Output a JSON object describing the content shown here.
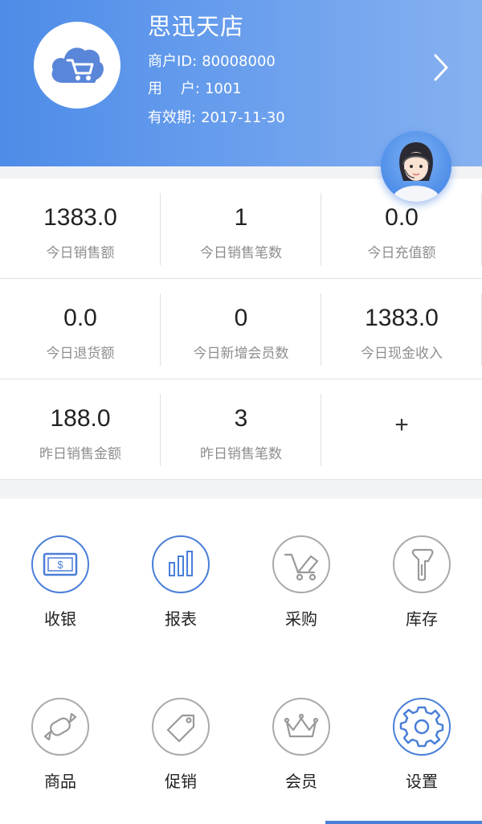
{
  "header": {
    "store_name": "思迅天店",
    "merchant_id_label": "商户ID:",
    "merchant_id": "80008000",
    "user_label": "用    户:",
    "user": "1001",
    "expiry_label": "有效期:",
    "expiry": "2017-11-30"
  },
  "stats": {
    "rows": [
      [
        {
          "value": "1383.0",
          "label": "今日销售额"
        },
        {
          "value": "1",
          "label": "今日销售笔数"
        },
        {
          "value": "0.0",
          "label": "今日充值额"
        }
      ],
      [
        {
          "value": "0.0",
          "label": "今日退货额"
        },
        {
          "value": "0",
          "label": "今日新增会员数"
        },
        {
          "value": "1383.0",
          "label": "今日现金收入"
        }
      ],
      [
        {
          "value": "188.0",
          "label": "昨日销售金额"
        },
        {
          "value": "3",
          "label": "昨日销售笔数"
        },
        {
          "value": "+",
          "label": ""
        }
      ]
    ]
  },
  "menu": {
    "items": [
      {
        "label": "收银",
        "icon": "cash-register-icon"
      },
      {
        "label": "报表",
        "icon": "bar-chart-icon"
      },
      {
        "label": "采购",
        "icon": "cart-icon"
      },
      {
        "label": "库存",
        "icon": "scanner-icon"
      },
      {
        "label": "商品",
        "icon": "candy-icon"
      },
      {
        "label": "促销",
        "icon": "tag-icon"
      },
      {
        "label": "会员",
        "icon": "crown-icon"
      },
      {
        "label": "设置",
        "icon": "gear-icon"
      }
    ]
  },
  "colors": {
    "header_start": "#4d8ce8",
    "header_end": "#86b1f0",
    "accent": "#4a7fd8",
    "muted_icon": "#aaaaaa"
  }
}
